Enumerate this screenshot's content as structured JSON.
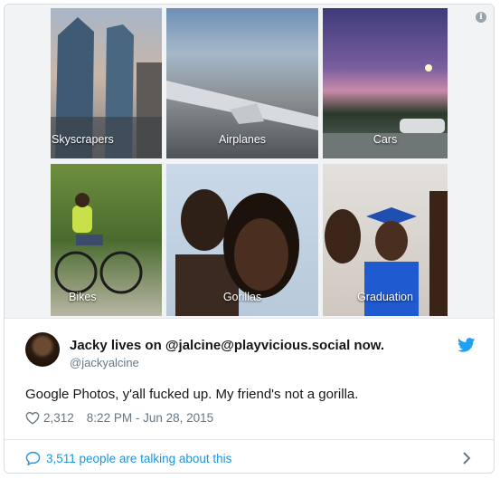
{
  "media": {
    "tiles": [
      {
        "label": "Skyscrapers"
      },
      {
        "label": "Airplanes"
      },
      {
        "label": "Cars"
      },
      {
        "label": "Bikes"
      },
      {
        "label": "Gorillas"
      },
      {
        "label": "Graduation"
      }
    ]
  },
  "tweet": {
    "name": "Jacky lives on @jalcine@playvicious.social now.",
    "handle": "@jackyalcine",
    "text": "Google Photos, y'all fucked up. My friend's not a gorilla.",
    "likes": "2,312",
    "timestamp": "8:22 PM - Jun 28, 2015",
    "talking": "3,511 people are talking about this"
  },
  "colors": {
    "link": "#1b95e0",
    "muted": "#657786",
    "bird": "#1da1f2"
  },
  "icons": [
    "info-icon",
    "twitter-bird-icon",
    "heart-icon",
    "speech-bubble-icon",
    "chevron-right-icon"
  ]
}
